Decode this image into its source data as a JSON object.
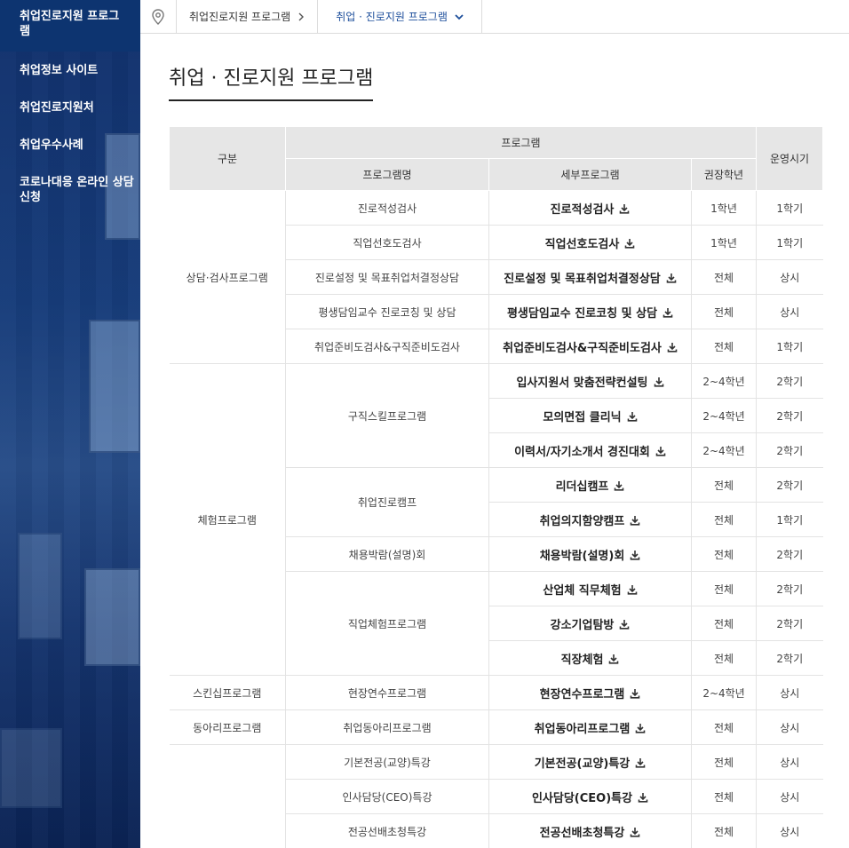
{
  "sidebar": {
    "active": "취업진로지원 프로그램",
    "items": [
      {
        "label": "취업정보 사이트"
      },
      {
        "label": "취업진로지원처"
      },
      {
        "label": "취업우수사례"
      },
      {
        "label": "코로나대응 온라인 상담신청"
      }
    ]
  },
  "breadcrumb": {
    "home_icon": "map-pin-icon",
    "parent": "취업진로지원 프로그램",
    "current": "취업 · 진로지원 프로그램"
  },
  "title": "취업 · 진로지원 프로그램",
  "table": {
    "headers": {
      "category": "구분",
      "program": "프로그램",
      "name": "프로그램명",
      "detail": "세부프로그램",
      "grade": "권장학년",
      "schedule": "운영시기"
    },
    "groups": [
      {
        "category": "상담·검사프로그램",
        "programs": [
          {
            "name": "진로적성검사",
            "details": [
              {
                "label": "진로적성검사",
                "grade": "1학년",
                "schedule": "1학기"
              }
            ]
          },
          {
            "name": "직업선호도검사",
            "details": [
              {
                "label": "직업선호도검사",
                "grade": "1학년",
                "schedule": "1학기"
              }
            ]
          },
          {
            "name": "진로설정 및 목표취업처결정상담",
            "details": [
              {
                "label": "진로설정 및 목표취업처결정상담",
                "grade": "전체",
                "schedule": "상시"
              }
            ]
          },
          {
            "name": "평생담임교수 진로코칭 및 상담",
            "details": [
              {
                "label": "평생담임교수 진로코칭 및 상담",
                "grade": "전체",
                "schedule": "상시"
              }
            ]
          },
          {
            "name": "취업준비도검사&구직준비도검사",
            "details": [
              {
                "label": "취업준비도검사&구직준비도검사",
                "grade": "전체",
                "schedule": "1학기"
              }
            ]
          }
        ]
      },
      {
        "category": "체험프로그램",
        "programs": [
          {
            "name": "구직스킬프로그램",
            "details": [
              {
                "label": "입사지원서 맞춤전략컨설팅",
                "grade": "2~4학년",
                "schedule": "2학기"
              },
              {
                "label": "모의면접 클리닉",
                "grade": "2~4학년",
                "schedule": "2학기"
              },
              {
                "label": "이력서/자기소개서 경진대회",
                "grade": "2~4학년",
                "schedule": "2학기"
              }
            ]
          },
          {
            "name": "취업진로캠프",
            "details": [
              {
                "label": "리더십캠프",
                "grade": "전체",
                "schedule": "2학기"
              },
              {
                "label": "취업의지함양캠프",
                "grade": "전체",
                "schedule": "1학기"
              }
            ]
          },
          {
            "name": "채용박람(설명)회",
            "details": [
              {
                "label": "채용박람(설명)회",
                "grade": "전체",
                "schedule": "2학기"
              }
            ]
          },
          {
            "name": "직업체험프로그램",
            "details": [
              {
                "label": "산업체 직무체험",
                "grade": "전체",
                "schedule": "2학기"
              },
              {
                "label": "강소기업탐방",
                "grade": "전체",
                "schedule": "2학기"
              },
              {
                "label": "직장체험",
                "grade": "전체",
                "schedule": "2학기"
              }
            ]
          }
        ]
      },
      {
        "category": "스킨십프로그램",
        "programs": [
          {
            "name": "현장연수프로그램",
            "details": [
              {
                "label": "현장연수프로그램",
                "grade": "2~4학년",
                "schedule": "상시"
              }
            ]
          }
        ]
      },
      {
        "category": "동아리프로그램",
        "programs": [
          {
            "name": "취업동아리프로그램",
            "details": [
              {
                "label": "취업동아리프로그램",
                "grade": "전체",
                "schedule": "상시"
              }
            ]
          }
        ]
      },
      {
        "category": "",
        "programs": [
          {
            "name": "기본전공(교양)특강",
            "details": [
              {
                "label": "기본전공(교양)특강",
                "grade": "전체",
                "schedule": "상시"
              }
            ]
          },
          {
            "name": "인사담당(CEO)특강",
            "details": [
              {
                "label": "인사담당(CEO)특강",
                "grade": "전체",
                "schedule": "상시"
              }
            ]
          },
          {
            "name": "전공선배초청특강",
            "details": [
              {
                "label": "전공선배초청특강",
                "grade": "전체",
                "schedule": "상시"
              }
            ]
          }
        ]
      }
    ]
  },
  "icons": {
    "download": "download-icon",
    "chevron": "chevron-right-icon",
    "dropdown": "chevron-down-icon"
  },
  "colors": {
    "sidebar_active": "#0d3470",
    "breadcrumb_current": "#1d4e9b",
    "header_bg": "#e6e6e6"
  }
}
